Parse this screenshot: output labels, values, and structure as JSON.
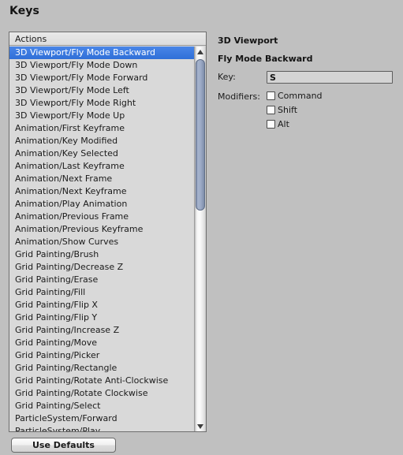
{
  "window": {
    "title": "Keys",
    "background_color": "#c0c0c0"
  },
  "list": {
    "header": "Actions",
    "selection_color": "#3a7ae0",
    "selected_index": 0,
    "items": [
      "3D Viewport/Fly Mode Backward",
      "3D Viewport/Fly Mode Down",
      "3D Viewport/Fly Mode Forward",
      "3D Viewport/Fly Mode Left",
      "3D Viewport/Fly Mode Right",
      "3D Viewport/Fly Mode Up",
      "Animation/First Keyframe",
      "Animation/Key Modified",
      "Animation/Key Selected",
      "Animation/Last Keyframe",
      "Animation/Next Frame",
      "Animation/Next Keyframe",
      "Animation/Play Animation",
      "Animation/Previous Frame",
      "Animation/Previous Keyframe",
      "Animation/Show Curves",
      "Grid Painting/Brush",
      "Grid Painting/Decrease Z",
      "Grid Painting/Erase",
      "Grid Painting/Fill",
      "Grid Painting/Flip X",
      "Grid Painting/Flip Y",
      "Grid Painting/Increase Z",
      "Grid Painting/Move",
      "Grid Painting/Picker",
      "Grid Painting/Rectangle",
      "Grid Painting/Rotate Anti-Clockwise",
      "Grid Painting/Rotate Clockwise",
      "Grid Painting/Select",
      "ParticleSystem/Forward",
      "ParticleSystem/Play"
    ],
    "scrollbar": {
      "up_arrow": "scroll-up-arrow",
      "down_arrow": "scroll-down-arrow"
    }
  },
  "detail": {
    "category": "3D Viewport",
    "action": "Fly Mode Backward",
    "key_label": "Key:",
    "key_value": "S",
    "key_placeholder": "",
    "modifiers_label": "Modifiers:",
    "modifiers": [
      {
        "label": "Command",
        "checked": false
      },
      {
        "label": "Shift",
        "checked": false
      },
      {
        "label": "Alt",
        "checked": false
      }
    ]
  },
  "footer": {
    "use_defaults_label": "Use Defaults"
  }
}
